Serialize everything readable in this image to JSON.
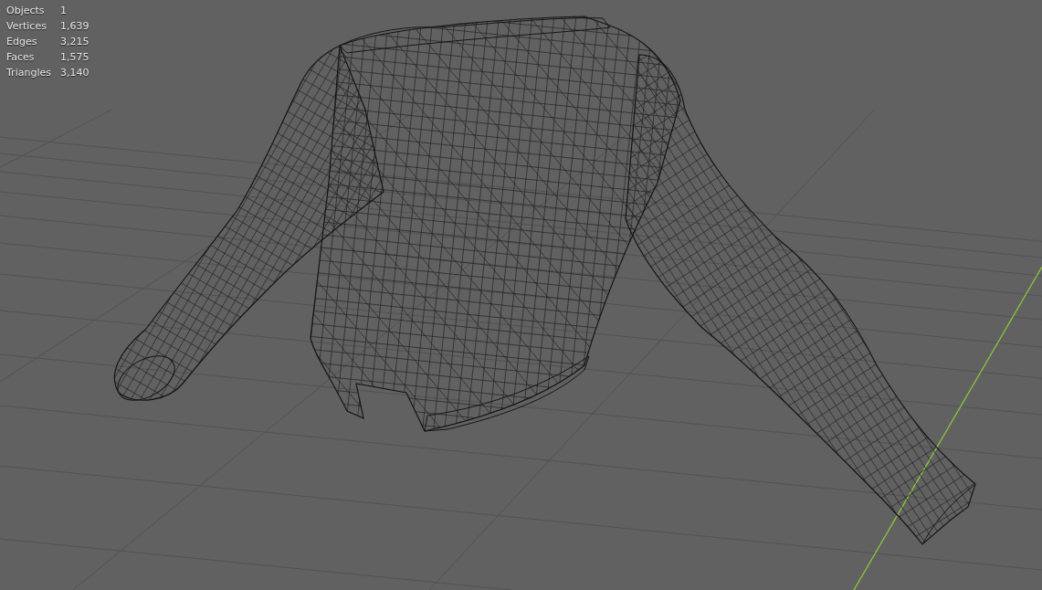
{
  "viewport": {
    "statistics": [
      {
        "label": "Objects",
        "value": "1"
      },
      {
        "label": "Vertices",
        "value": "1,639"
      },
      {
        "label": "Edges",
        "value": "3,215"
      },
      {
        "label": "Faces",
        "value": "1,575"
      },
      {
        "label": "Triangles",
        "value": "3,140"
      }
    ]
  }
}
